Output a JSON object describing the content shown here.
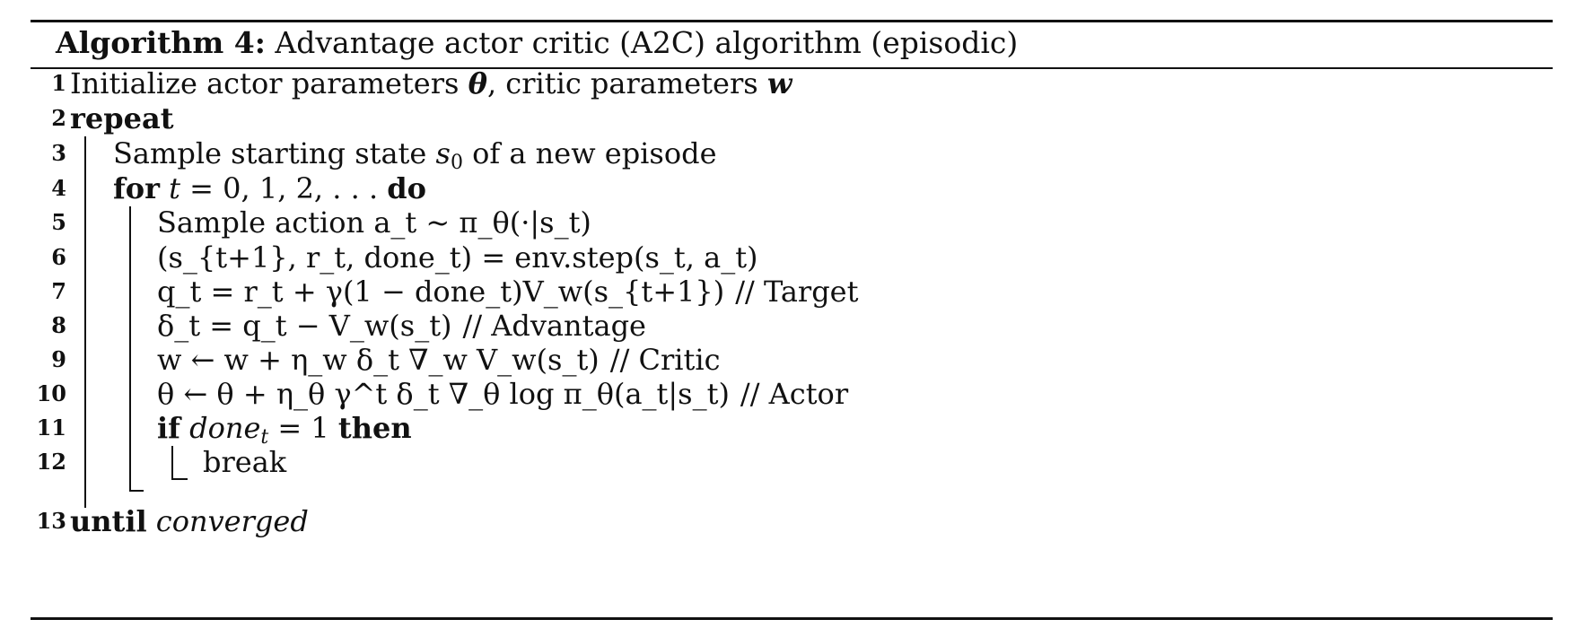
{
  "caption": {
    "label": "Algorithm 4:",
    "title": " Advantage actor critic (A2C) algorithm (episodic)"
  },
  "lines": [
    {
      "num": "1",
      "pre": "Initialize actor parameters ",
      "theta": "θ",
      "mid": ", critic parameters ",
      "w": "w"
    },
    {
      "num": "2",
      "kw": "repeat"
    },
    {
      "num": "3",
      "pre": "Sample starting state ",
      "s": "s",
      "sub": "0",
      "post": " of a new episode"
    },
    {
      "num": "4",
      "kw_for": "for",
      "t": "t",
      "eq": " = 0, 1, 2, . . . ",
      "kw_do": "do"
    },
    {
      "num": "5",
      "text": "Sample action a_t ~ π_θ(·|s_t)"
    },
    {
      "num": "6",
      "text": "(s_{t+1}, r_t, done_t) = env.step(s_t, a_t)"
    },
    {
      "num": "7",
      "text": "q_t = r_t + γ(1 − done_t)V_w(s_{t+1})",
      "comment": "// Target"
    },
    {
      "num": "8",
      "text": "δ_t = q_t − V_w(s_t)",
      "comment": "// Advantage"
    },
    {
      "num": "9",
      "text": "w ← w + η_w δ_t ∇_w V_w(s_t)",
      "comment": "// Critic"
    },
    {
      "num": "10",
      "text": "θ ← θ + η_θ γ^t δ_t ∇_θ log π_θ(a_t|s_t)",
      "comment": "// Actor"
    },
    {
      "num": "11",
      "kw_if": "if",
      "cond": "done",
      "cond_sub": "t",
      "cond_rest": " = 1 ",
      "kw_then": "then"
    },
    {
      "num": "12",
      "text": "break"
    },
    {
      "num": "13",
      "kw": "until",
      "cond": "converged"
    }
  ]
}
